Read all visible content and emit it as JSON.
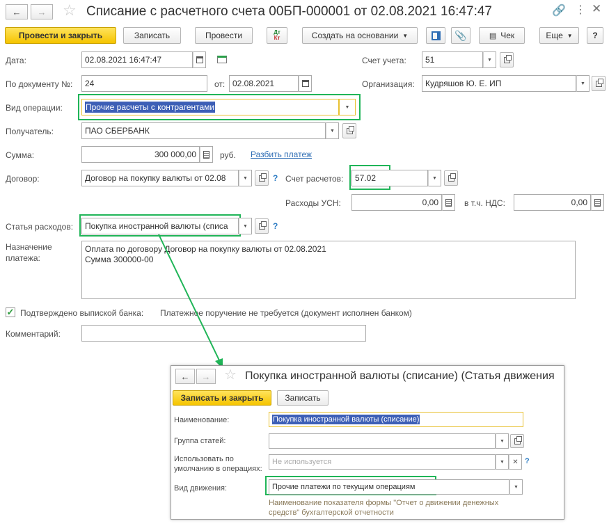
{
  "window": {
    "title": "Списание с расчетного счета 00БП-000001 от 02.08.2021 16:47:47"
  },
  "toolbar": {
    "post_close": "Провести и закрыть",
    "save": "Записать",
    "post": "Провести",
    "dtkt_top": "Дт",
    "dtkt_bottom": "Кт",
    "create_based": "Создать на основании",
    "check": "Чек",
    "more": "Еще",
    "help": "?"
  },
  "form": {
    "date_label": "Дата:",
    "date_value": "02.08.2021 16:47:47",
    "account_label": "Счет учета:",
    "account_value": "51",
    "doc_no_label": "По документу №:",
    "doc_no_value": "24",
    "from_label": "от:",
    "from_value": "02.08.2021",
    "org_label": "Организация:",
    "org_value": "Кудряшов Ю. Е. ИП",
    "op_type_label": "Вид операции:",
    "op_type_value": "Прочие расчеты с контрагентами",
    "recipient_label": "Получатель:",
    "recipient_value": "ПАО СБЕРБАНК",
    "sum_label": "Сумма:",
    "sum_value": "300 000,00",
    "currency": "руб.",
    "split_link": "Разбить платеж",
    "contract_label": "Договор:",
    "contract_value": "Договор на покупку валюты от 02.08",
    "settle_label": "Счет расчетов:",
    "settle_value": "57.02",
    "usn_label": "Расходы УСН:",
    "usn_value": "0,00",
    "vat_label": "в т.ч. НДС:",
    "vat_value": "0,00",
    "expense_label": "Статья расходов:",
    "expense_value": "Покупка иностранной валюты (списа",
    "purpose_label_1": "Назначение",
    "purpose_label_2": "платежа:",
    "purpose_line_1": "Оплата по договору Договор на покупку валюты от 02.08.2021",
    "purpose_line_2": "Сумма 300000-00",
    "confirmed_label": "Подтверждено выпиской банка:",
    "confirmed_note": "Платежное поручение не требуется (документ исполнен банком)",
    "comment_label": "Комментарий:",
    "comment_value": ""
  },
  "popup": {
    "title": "Покупка иностранной валюты (списание) (Статья движения",
    "save_close": "Записать и закрыть",
    "save": "Записать",
    "name_label": "Наименование:",
    "name_value": "Покупка иностранной валюты (списание)",
    "group_label": "Группа статей:",
    "group_value": "",
    "default_label_1": "Использовать по",
    "default_label_2": "умолчанию в операциях:",
    "default_placeholder": "Не используется",
    "movement_label": "Вид движения:",
    "movement_value": "Прочие платежи по текущим операциям",
    "hint_1": "Наименование показателя формы \"Отчет о движении денежных",
    "hint_2": "средств\" бухгалтерской отчетности"
  },
  "colors": {
    "accent_yellow": "#f5c400",
    "highlight_green": "#20b558",
    "selection_blue": "#3d5fb6",
    "link_blue": "#2e6db4"
  }
}
